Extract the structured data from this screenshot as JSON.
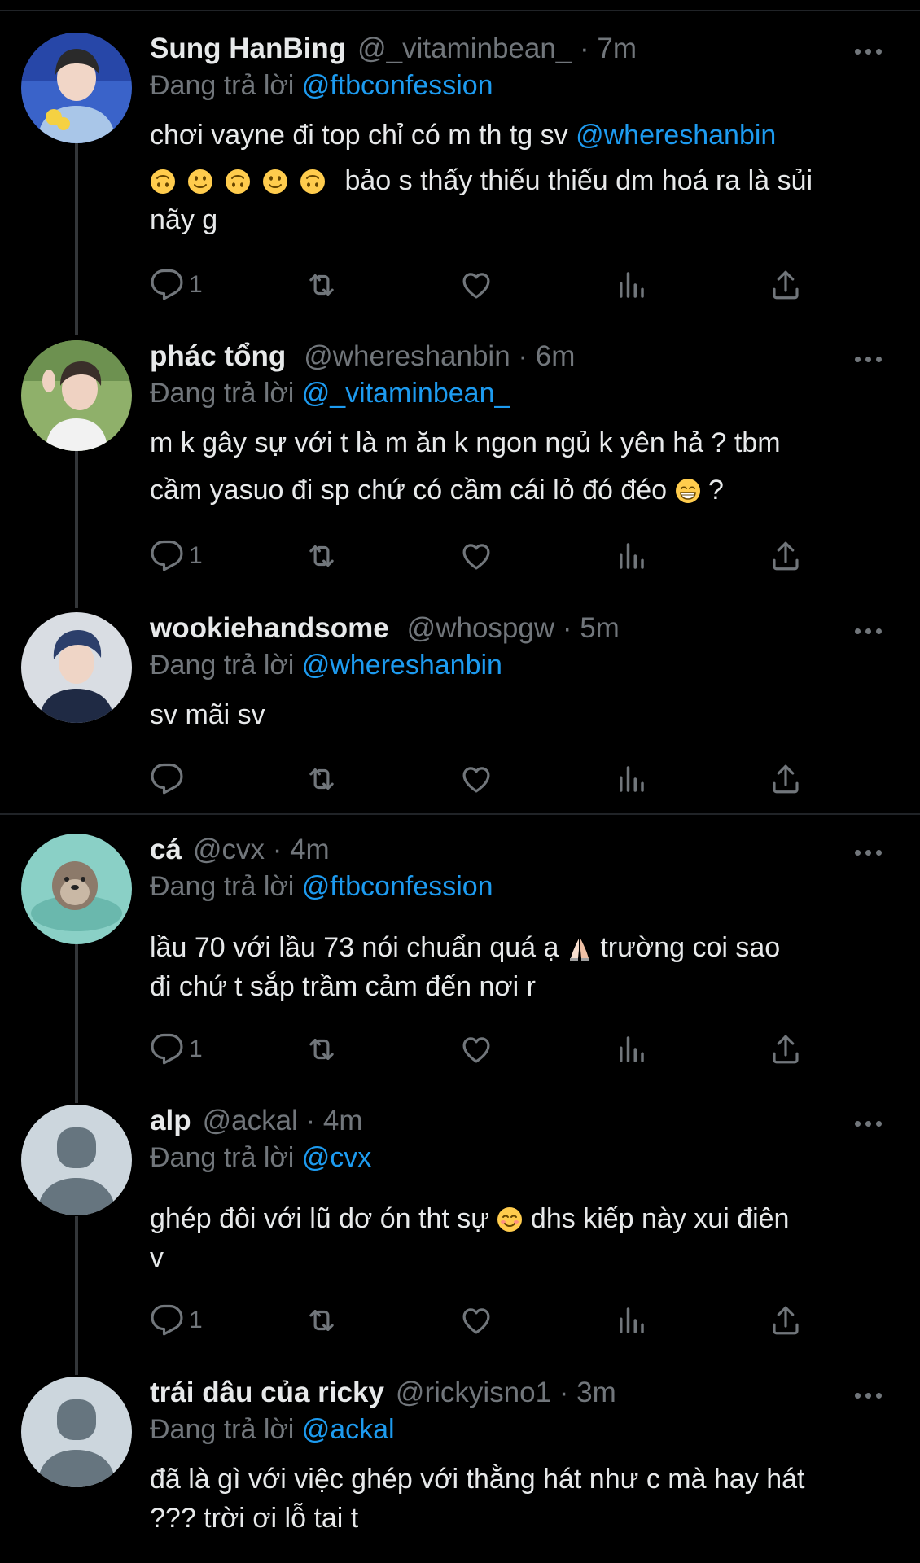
{
  "tweets": [
    {
      "name": "Sung HanBing",
      "handle": "@_vitaminbean_ · 7m",
      "reply_prefix": "Đang trả lời",
      "reply_to": "@ftbconfession",
      "line1_text": "chơi vayne đi top chỉ có m th tg sv ",
      "line1_link": "@whereshanbin",
      "line2_emojis": [
        "upside-down-face",
        "slightly-smiling-face",
        "upside-down-face",
        "slightly-smiling-face",
        "upside-down-face"
      ],
      "line2_text": " bảo s thấy thiếu thiếu dm hoá ra là sủi",
      "line3_text": "nãy g",
      "reply_count": "1"
    },
    {
      "name": "phác tổng",
      "handle": "@whereshanbin · 6m",
      "reply_prefix": "Đang trả lời",
      "reply_to": "@_vitaminbean_",
      "line1_text": "m k gây sự với t là m ăn k ngon ngủ k yên hả ? tbm",
      "line2_text": "cầm yasuo đi sp chứ có cầm cái lỏ đó đéo ",
      "line2_emoji": "grinning-face",
      "line2_end": " ?",
      "reply_count": "1"
    },
    {
      "name": "wookiehandsome",
      "handle": "@whospgw · 5m",
      "reply_prefix": "Đang trả lời",
      "reply_to": "@whereshanbin",
      "line1_text": "sv mãi sv",
      "reply_count": ""
    },
    {
      "name": "cá",
      "handle": "@cvx · 4m",
      "reply_prefix": "Đang trả lời",
      "reply_to": "@ftbconfession",
      "line1_text": "lầu 70 với lầu 73 nói chuẩn quá ạ ",
      "line1_emoji": "folded-hands",
      "line1_end": " trường coi sao",
      "line2_text": "đi chứ t sắp trầm cảm đến nơi r",
      "reply_count": "1"
    },
    {
      "name": "alp",
      "handle": "@ackal · 4m",
      "reply_prefix": "Đang trả lời",
      "reply_to": "@cvx",
      "line1_text": "ghép đôi với lũ dơ ón tht sự ",
      "line1_emoji": "smiling-face",
      "line1_end": " dhs kiếp này xui điên",
      "line2_text": "v",
      "reply_count": "1"
    },
    {
      "name": "trái dâu của ricky",
      "handle": "@rickyisno1 · 3m",
      "reply_prefix": "Đang trả lời",
      "reply_to": "@ackal",
      "line1_text": "đã là gì với việc ghép với thằng hát như c mà hay hát",
      "line2_text": "??? trời ơi lỗ tai t"
    }
  ],
  "colors": {
    "background": "#000000",
    "text": "#e7e9ea",
    "muted": "#71767b",
    "link": "#1d9bf0",
    "divider": "#202327"
  }
}
